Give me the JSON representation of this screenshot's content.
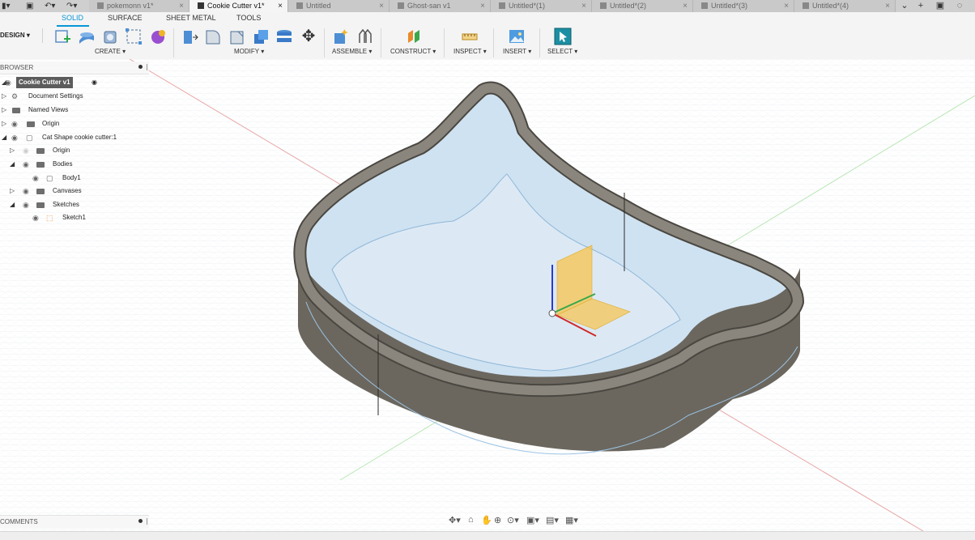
{
  "quick_access": {
    "menu_icon": "menu-icon",
    "save_icon": "save-icon",
    "undo_icon": "undo-icon",
    "redo_icon": "redo-icon"
  },
  "doc_tabs": [
    {
      "label": "pokemonn v1*",
      "active": false
    },
    {
      "label": "Cookie Cutter v1*",
      "active": true
    },
    {
      "label": "Untitled",
      "active": false
    },
    {
      "label": "Ghost-san v1",
      "active": false
    },
    {
      "label": "Untitled*(1)",
      "active": false
    },
    {
      "label": "Untitled*(2)",
      "active": false
    },
    {
      "label": "Untitled*(3)",
      "active": false
    },
    {
      "label": "Untitled*(4)",
      "active": false
    }
  ],
  "tab_close_glyph": "×",
  "ribbon": {
    "workspace": "DESIGN ▾",
    "tabs": [
      "SOLID",
      "SURFACE",
      "SHEET METAL",
      "TOOLS"
    ],
    "active_tab": "SOLID",
    "groups": {
      "create": "CREATE ▾",
      "modify": "MODIFY ▾",
      "assemble": "ASSEMBLE ▾",
      "construct": "CONSTRUCT ▾",
      "inspect": "INSPECT ▾",
      "insert": "INSERT ▾",
      "select": "SELECT ▾"
    }
  },
  "browser": {
    "title": "BROWSER",
    "items": [
      {
        "label": "Cookie Cutter v1"
      },
      {
        "label": "Document Settings"
      },
      {
        "label": "Named Views"
      },
      {
        "label": "Origin"
      },
      {
        "label": "Cat Shape cookie cutter:1"
      },
      {
        "label": "Origin"
      },
      {
        "label": "Bodies"
      },
      {
        "label": "Body1"
      },
      {
        "label": "Canvases"
      },
      {
        "label": "Sketches"
      },
      {
        "label": "Sketch1"
      }
    ]
  },
  "comments": {
    "title": "COMMENTS"
  },
  "colors": {
    "accent": "#0696d7",
    "wall": "#5d5a53",
    "plane": "#f7c34c",
    "grid": "#dde2e6"
  }
}
